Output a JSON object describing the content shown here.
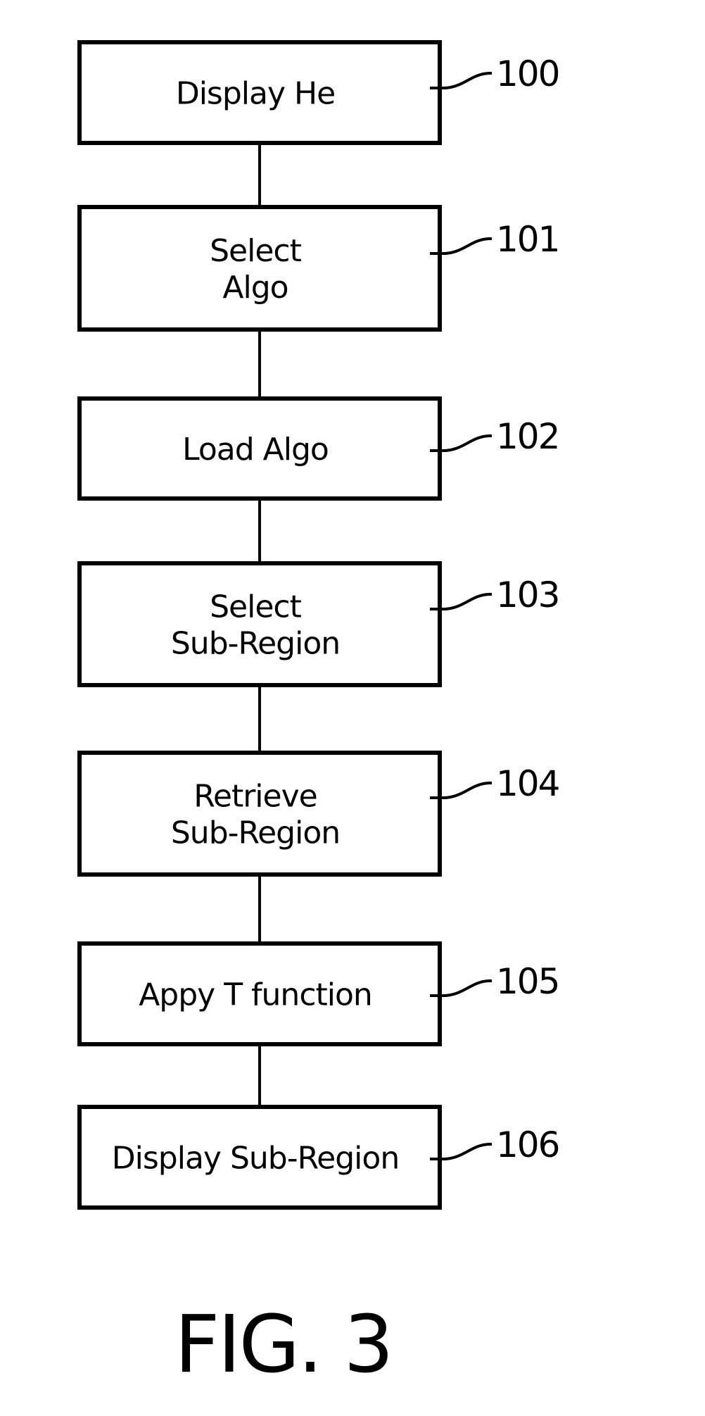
{
  "figure": {
    "caption": "FIG. 3",
    "type": "flowchart",
    "steps": [
      {
        "ref": "100",
        "lines": [
          "Display He"
        ]
      },
      {
        "ref": "101",
        "lines": [
          "Select",
          "Algo"
        ]
      },
      {
        "ref": "102",
        "lines": [
          "Load Algo"
        ]
      },
      {
        "ref": "103",
        "lines": [
          "Select",
          "Sub-Region"
        ]
      },
      {
        "ref": "104",
        "lines": [
          "Retrieve",
          "Sub-Region"
        ]
      },
      {
        "ref": "105",
        "lines": [
          "Appy T function"
        ]
      },
      {
        "ref": "106",
        "lines": [
          "Display Sub-Region"
        ]
      }
    ],
    "colors": {
      "stroke": "#000000",
      "background": "#ffffff"
    }
  }
}
